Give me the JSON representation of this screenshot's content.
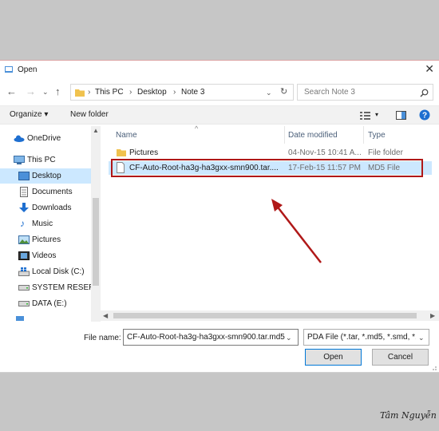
{
  "window": {
    "title": "Open"
  },
  "address": {
    "segments": [
      "This PC",
      "Desktop",
      "Note 3"
    ]
  },
  "search": {
    "placeholder": "Search Note 3"
  },
  "toolbar": {
    "organize": "Organize ▾",
    "new_folder": "New folder"
  },
  "sidebar": {
    "items": [
      {
        "label": "OneDrive"
      },
      {
        "label": "This PC"
      },
      {
        "label": "Desktop"
      },
      {
        "label": "Documents"
      },
      {
        "label": "Downloads"
      },
      {
        "label": "Music"
      },
      {
        "label": "Pictures"
      },
      {
        "label": "Videos"
      },
      {
        "label": "Local Disk (C:)"
      },
      {
        "label": "SYSTEM RESERV"
      },
      {
        "label": "DATA (E:)"
      }
    ]
  },
  "columns": {
    "name": "Name",
    "date": "Date modified",
    "type": "Type"
  },
  "files": [
    {
      "name": "Pictures",
      "date": "04-Nov-15 10:41 A...",
      "type": "File folder"
    },
    {
      "name": "CF-Auto-Root-ha3g-ha3gxx-smn900.tar....",
      "date": "17-Feb-15 11:57 PM",
      "type": "MD5 File"
    }
  ],
  "bottom": {
    "file_name_label": "File name:",
    "file_name_value": "CF-Auto-Root-ha3g-ha3gxx-smn900.tar.md5",
    "file_type_value": "PDA File (*.tar, *.md5, *.smd, *.",
    "open": "Open",
    "cancel": "Cancel"
  },
  "signature": "Tâm Nguyễn",
  "colors": {
    "selection": "#cce8ff",
    "highlight_box": "#b01818",
    "arrow": "#b01818",
    "folder": "#f0c24e"
  }
}
